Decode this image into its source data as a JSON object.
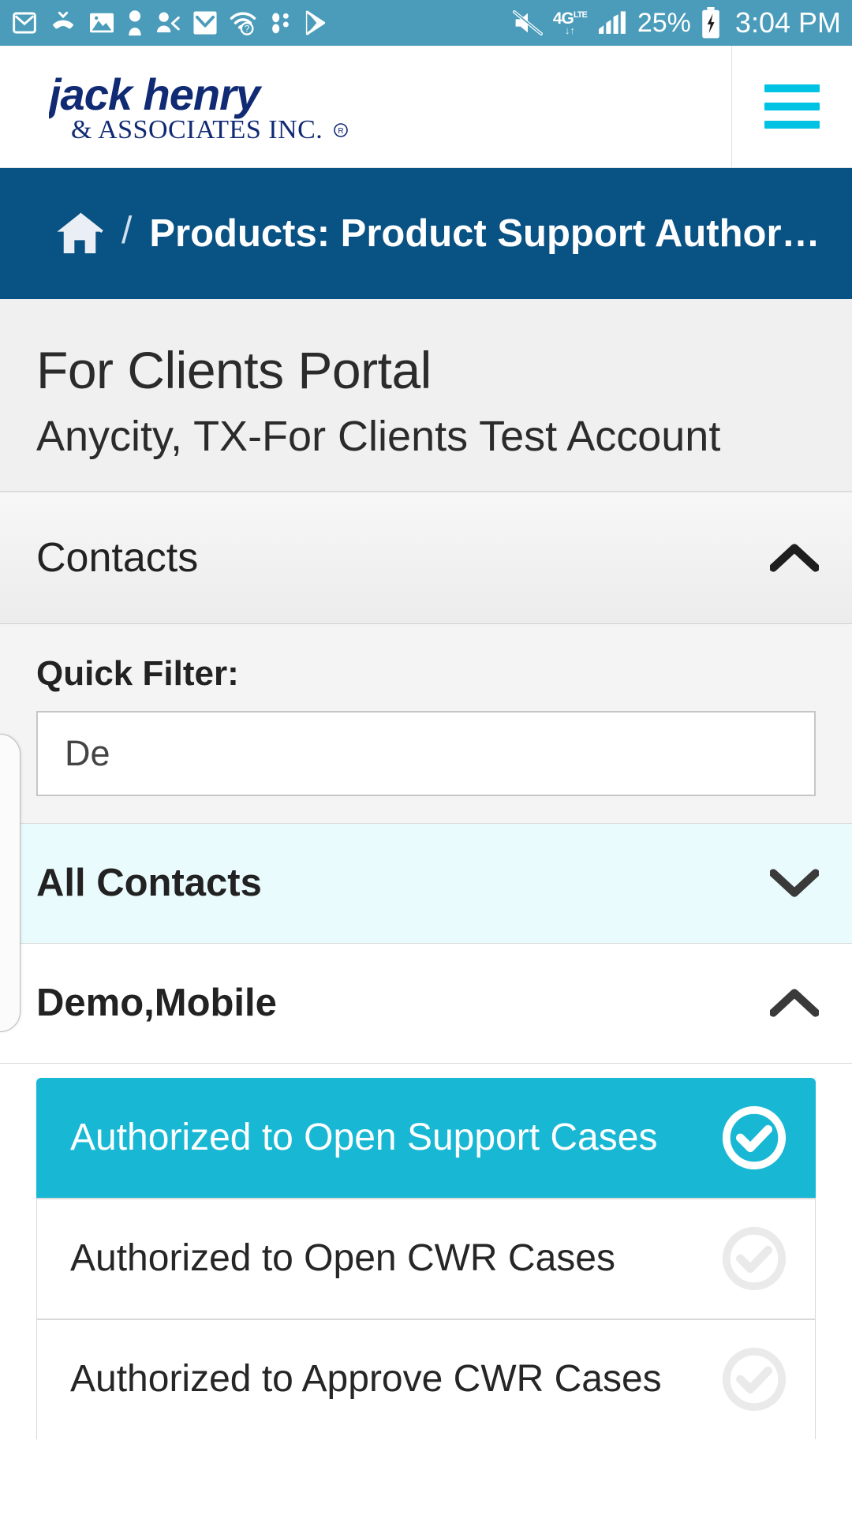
{
  "statusbar": {
    "icons_left": [
      "gmail-icon",
      "missed-call-icon",
      "photo-icon",
      "contact-icon",
      "contact-share-icon",
      "email-icon",
      "wifi-question-icon",
      "bluetooth-devices-icon",
      "play-store-icon"
    ],
    "mute_icon": "volume-mute-icon",
    "network_type": "4G",
    "network_sub": "LTE",
    "signal_icon": "signal-bars-icon",
    "battery_percent": "25%",
    "battery_icon": "battery-charging-icon",
    "time": "3:04 PM"
  },
  "header": {
    "logo_name": "jack henry",
    "logo_sub": "& ASSOCIATES INC.",
    "logo_registered": "®",
    "menu_icon": "hamburger-menu-icon",
    "accent_color": "#00c3e3"
  },
  "breadcrumb": {
    "home_icon": "home-icon",
    "separator": "/",
    "current": "Products: Product Support Author…",
    "background_color": "#095284"
  },
  "page": {
    "title": "For Clients Portal",
    "subtitle": "Anycity, TX-For Clients Test Account"
  },
  "contacts_panel": {
    "header_label": "Contacts",
    "header_chevron": "chevron-up-icon",
    "filter_label": "Quick Filter:",
    "filter_value": "De",
    "filter_placeholder": "De"
  },
  "groups": [
    {
      "label": "All Contacts",
      "chevron": "chevron-down-icon",
      "expanded": false,
      "highlight_color": "#e9fbfd"
    },
    {
      "label": "Demo,Mobile",
      "chevron": "chevron-up-icon",
      "expanded": true,
      "highlight_color": "#ffffff"
    }
  ],
  "permissions": [
    {
      "label": "Authorized to Open Support Cases",
      "enabled": true,
      "icon": "check-circle-icon"
    },
    {
      "label": "Authorized to Open CWR Cases",
      "enabled": false,
      "icon": "check-circle-icon"
    },
    {
      "label": "Authorized to Approve CWR Cases",
      "enabled": false,
      "icon": "check-circle-icon"
    }
  ],
  "colors": {
    "status_bar": "#4a9cba",
    "brand_navy": "#0d2f78",
    "breadcrumb_navy": "#095284",
    "teal_active": "#18b8d4",
    "cyan_accent": "#00c3e3"
  },
  "edge_handle": {
    "name": "edge-swipe-drawer-handle"
  }
}
